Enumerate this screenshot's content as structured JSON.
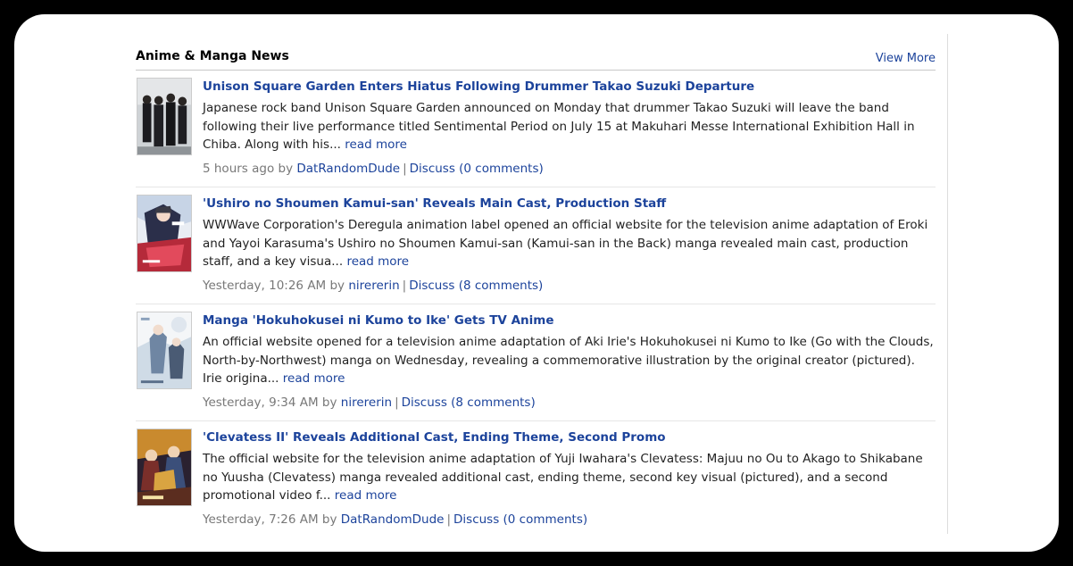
{
  "section": {
    "title": "Anime & Manga News",
    "view_more": "View More"
  },
  "colors": {
    "link": "#1c439b",
    "meta_text": "#787878",
    "body_text": "#222222"
  },
  "articles": [
    {
      "title": "Unison Square Garden Enters Hiatus Following Drummer Takao Suzuki Departure",
      "excerpt": "Japanese rock band Unison Square Garden announced on Monday that drummer Takao Suzuki will leave the band following their live performance titled Sentimental Period on July 15 at Makuhari Messe International Exhibition Hall in Chiba. Along with his...",
      "read_more": "read more",
      "time": "5 hours ago by",
      "author": "DatRandomDude",
      "discuss": "Discuss (0 comments)"
    },
    {
      "title": "'Ushiro no Shoumen Kamui-san' Reveals Main Cast, Production Staff",
      "excerpt": "WWWave Corporation's Deregula animation label opened an official website for the television anime adaptation of Eroki and Yayoi Karasuma's Ushiro no Shoumen Kamui-san (Kamui-san in the Back) manga revealed main cast, production staff, and a key visua...",
      "read_more": "read more",
      "time": "Yesterday, 10:26 AM by",
      "author": "nirererin",
      "discuss": "Discuss (8 comments)"
    },
    {
      "title": "Manga 'Hokuhokusei ni Kumo to Ike' Gets TV Anime",
      "excerpt": "An official website opened for a television anime adaptation of Aki Irie's Hokuhokusei ni Kumo to Ike (Go with the Clouds, North-by-Northwest) manga on Wednesday, revealing a commemorative illustration by the original creator (pictured). Irie origina...",
      "read_more": "read more",
      "time": "Yesterday, 9:34 AM by",
      "author": "nirererin",
      "discuss": "Discuss (8 comments)"
    },
    {
      "title": "'Clevatess II' Reveals Additional Cast, Ending Theme, Second Promo",
      "excerpt": "The official website for the television anime adaptation of Yuji Iwahara's Clevatess: Majuu no Ou to Akago to Shikabane no Yuusha (Clevatess) manga revealed additional cast, ending theme, second key visual (pictured), and a second promotional video f...",
      "read_more": "read more",
      "time": "Yesterday, 7:26 AM by",
      "author": "DatRandomDude",
      "discuss": "Discuss (0 comments)"
    }
  ]
}
